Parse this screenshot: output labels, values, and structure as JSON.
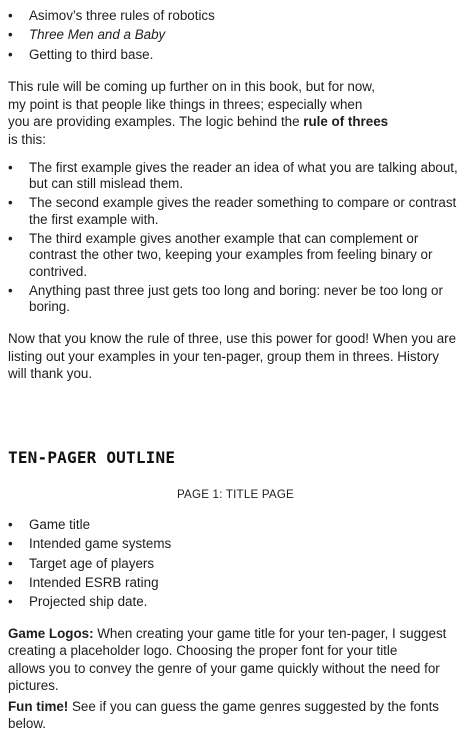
{
  "top_list": [
    {
      "text": "Asimov’s three rules of robotics",
      "italic": false
    },
    {
      "text": "Three Men and a Baby",
      "italic": true
    },
    {
      "text": "Getting to third base.",
      "italic": false
    }
  ],
  "intro": {
    "line1": "This rule will be coming up further on in this book, but for now,",
    "line2": "my point is that people like things in threes; especially when",
    "line3a": "you are providing examples. The logic behind the ",
    "line3b": "rule of threes",
    "line4": "is this:"
  },
  "threes_list": [
    {
      "l1": "The first example gives the reader an idea of what you are talking about,",
      "l2": "but can still mislead them.",
      "l3": ""
    },
    {
      "l1": "The second example gives the reader something to compare or contrast",
      "l2": "the first example with.",
      "l3": ""
    },
    {
      "l1": "The third example gives another example that can complement or",
      "l2": "contrast the other two, keeping your examples from feeling binary or",
      "l3": "contrived."
    },
    {
      "l1": "Anything past three just gets too long and boring: never be too long or",
      "l2": "boring.",
      "l3": ""
    }
  ],
  "conclusion": {
    "line1": "Now that you know the rule of three, use this power for good! When you are",
    "line2": "listing out your examples in your ten-pager, group them in threes. History",
    "line3": "will thank you."
  },
  "section_title": "TEN-PAGER OUTLINE",
  "page_caption": "PAGE 1: TITLE PAGE",
  "outline_list": [
    "Game title",
    "Intended game systems",
    "Target age of players",
    "Intended ESRB rating",
    "Projected ship date."
  ],
  "logos": {
    "label": "Game Logos:",
    "line1": " When creating your game title for your ten-pager, I suggest",
    "line2": "creating a placeholder logo. Choosing the proper font for your title",
    "line3": "allows you to convey the genre of your game quickly without the need for",
    "line4": "pictures."
  },
  "fun": {
    "label": "Fun time!",
    "line1": " See if you can guess the game genres suggested by the fonts",
    "line2": "below."
  },
  "bullet_glyph": "•"
}
